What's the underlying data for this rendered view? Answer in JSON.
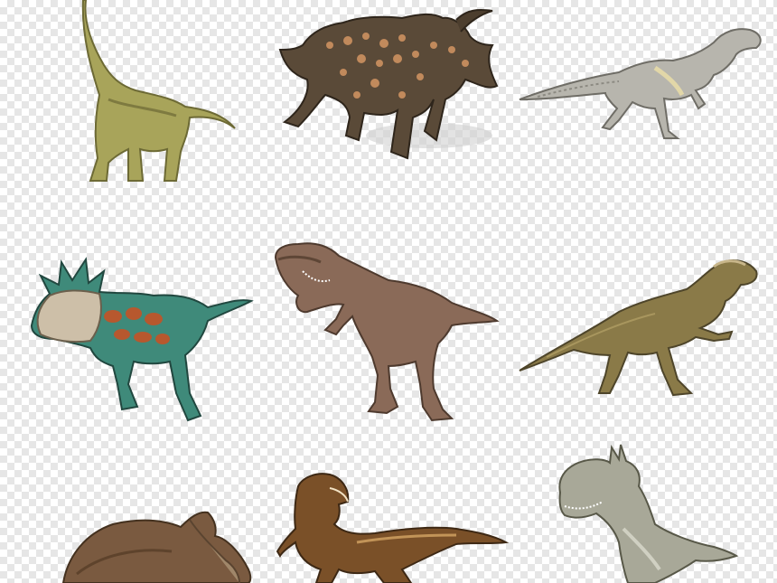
{
  "background": {
    "pattern": "transparency-checkerboard",
    "colors": [
      "#ffffff",
      "#e6e6e6"
    ]
  },
  "dinosaurs": [
    {
      "species": "brachiosaurus",
      "color": "#a8a45a"
    },
    {
      "species": "einiosaurus",
      "color": "#5a4a38"
    },
    {
      "species": "allosaurus",
      "color": "#b7b5ad"
    },
    {
      "species": "styracosaurus",
      "color": "#3f8a7a"
    },
    {
      "species": "tyrannosaurus",
      "color": "#8a6a58"
    },
    {
      "species": "dilophosaurus",
      "color": "#8a7a48"
    },
    {
      "species": "triceratops",
      "color": "#7a5a40"
    },
    {
      "species": "tyrannosaurus-juvenile",
      "color": "#7a5028"
    },
    {
      "species": "monolophosaurus",
      "color": "#a8a898"
    }
  ]
}
